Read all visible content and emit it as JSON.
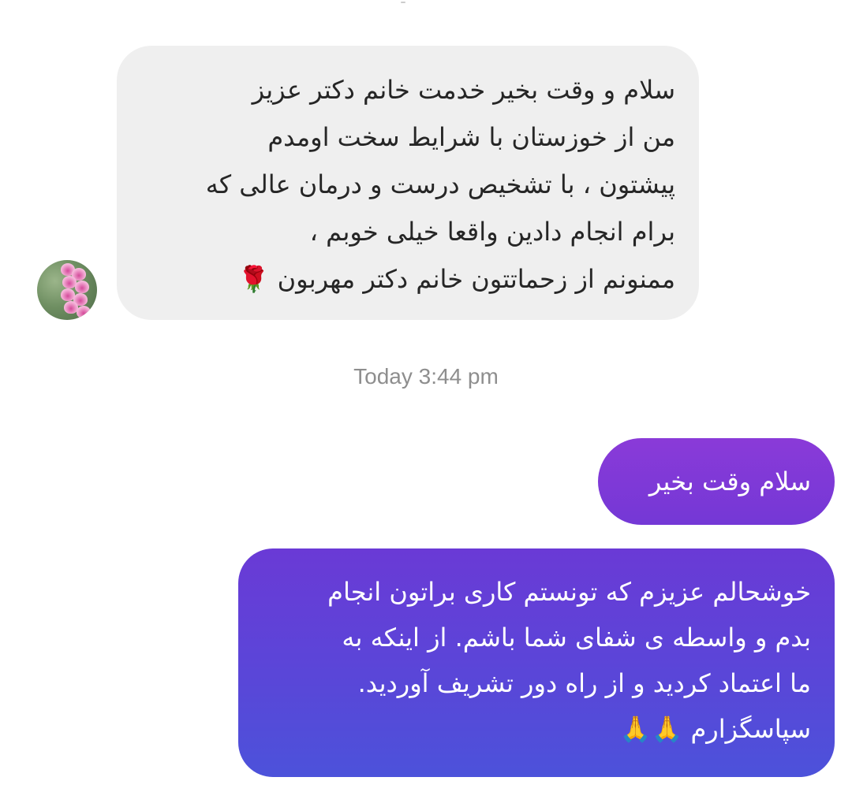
{
  "conversation": {
    "incoming_message": {
      "lines": [
        "سلام و وقت بخیر خدمت خانم دکتر عزیز",
        "من از خوزستان با شرایط سخت اومدم",
        "پیشتون ، با تشخیص درست و درمان عالی که",
        "برام انجام دادین واقعا خیلی خوبم ،",
        "ممنونم از زحماتتون خانم دکتر مهربون 🌹"
      ]
    },
    "timestamp": "Today 3:44 pm",
    "outgoing_messages": [
      {
        "lines": [
          "سلام وقت بخیر"
        ]
      },
      {
        "lines": [
          "خوشحالم عزیزم که تونستم کاری براتون انجام",
          "بدم و واسطه ی شفای شما باشم. از اینکه به",
          "ما اعتماد کردید و از راه دور تشریف آوردید.",
          "سپاسگزارم 🙏🙏"
        ]
      }
    ]
  },
  "colors": {
    "incoming_bubble": "#efefef",
    "incoming_text": "#262626",
    "outgoing_gradient_top": "#8a3ad8",
    "outgoing_gradient_bottom": "#4c52da",
    "outgoing_text": "#ffffff",
    "timestamp_text": "#8e8e8e"
  },
  "icons": {
    "avatar": "flower-avatar-icon"
  }
}
